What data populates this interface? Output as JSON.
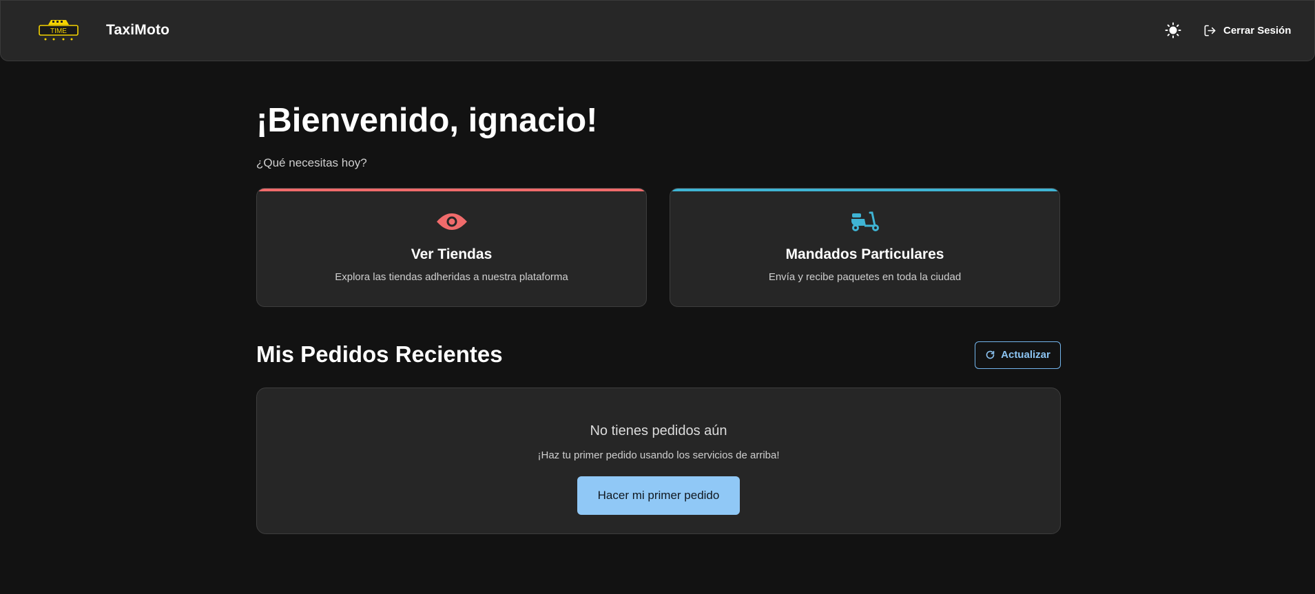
{
  "header": {
    "brand": "TaxiMoto",
    "logo_text": "TIME",
    "theme_icon": "sun-icon",
    "logout_icon": "logout-icon",
    "logout_label": "Cerrar Sesión"
  },
  "welcome": {
    "title": "¡Bienvenido, ignacio!",
    "subtitle": "¿Qué necesitas hoy?"
  },
  "services": [
    {
      "icon": "eye-icon",
      "title": "Ver Tiendas",
      "description": "Explora las tiendas adheridas a nuestra plataforma",
      "accent": "#f06b6b"
    },
    {
      "icon": "scooter-icon",
      "title": "Mandados Particulares",
      "description": "Envía y recibe paquetes en toda la ciudad",
      "accent": "#3fb4d4"
    }
  ],
  "orders": {
    "title": "Mis Pedidos Recientes",
    "refresh_label": "Actualizar",
    "refresh_icon": "refresh-icon",
    "empty_title": "No tienes pedidos aún",
    "empty_desc": "¡Haz tu primer pedido usando los servicios de arriba!",
    "cta_label": "Hacer mi primer pedido"
  },
  "colors": {
    "background": "#121212",
    "surface": "#262626",
    "primary": "#90c8f6",
    "logo": "#f5d300"
  }
}
